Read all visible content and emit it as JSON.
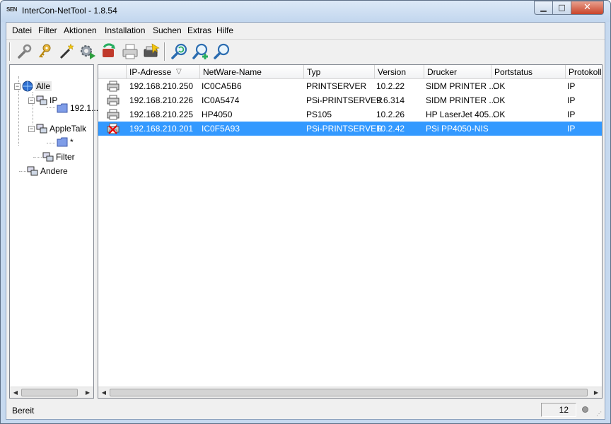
{
  "window": {
    "title": "InterCon-NetTool - 1.8.54",
    "app_icon_text": "SEN",
    "min": "▁",
    "max": "□",
    "close": "✕"
  },
  "menu": [
    "Datei",
    "Filter",
    "Aktionen",
    "Installation",
    "Suchen",
    "Extras",
    "Hilfe"
  ],
  "toolbar": {
    "icons": [
      "wrench-icon",
      "key-icon",
      "magic-wand-icon",
      "gear-run-icon",
      "refresh-printer-icon",
      "printer-icon",
      "printer-install-icon",
      "search-refresh-icon",
      "search-add-icon",
      "search-icon"
    ]
  },
  "tree": {
    "root": "Alle",
    "ip": "IP",
    "ip_child": "192.1...",
    "appletalk": "AppleTalk",
    "appletalk_child": "*",
    "filter": "Filter",
    "other": "Andere",
    "expander_minus": "−"
  },
  "list": {
    "columns": [
      "IP-Adresse",
      "NetWare-Name",
      "Typ",
      "Version",
      "Drucker",
      "Portstatus",
      "Protokoll"
    ],
    "sort_indicator": "▽",
    "rows": [
      {
        "ip": "192.168.210.250",
        "netware": "IC0CA5B6",
        "typ": "PRINTSERVER",
        "version": "10.2.22",
        "drucker": "SIDM PRINTER ...",
        "portstatus": "OK",
        "protokoll": "IP",
        "status_icon": "printer-icon"
      },
      {
        "ip": "192.168.210.226",
        "netware": "IC0A5474",
        "typ": "PSi-PRINTSERVER",
        "version": "9.6.314",
        "drucker": "SIDM PRINTER ...",
        "portstatus": "OK",
        "protokoll": "IP",
        "status_icon": "printer-icon"
      },
      {
        "ip": "192.168.210.225",
        "netware": "HP4050",
        "typ": "PS105",
        "version": "10.2.26",
        "drucker": "HP LaserJet 405...",
        "portstatus": "OK",
        "protokoll": "IP",
        "status_icon": "printer-icon"
      },
      {
        "ip": "192.168.210.201",
        "netware": "IC0F5A93",
        "typ": "PSi-PRINTSERVER",
        "version": "10.2.42",
        "drucker": "PSi PP4050-NIS",
        "portstatus": "",
        "protokoll": "IP",
        "status_icon": "printer-error-icon"
      }
    ],
    "selected_row": 3
  },
  "status": {
    "text": "Bereit",
    "count": "12"
  },
  "scroll": {
    "left": "◀",
    "right": "▶"
  },
  "colors": {
    "selection": "#3399ff",
    "titlebar": "#c6d9ef"
  }
}
